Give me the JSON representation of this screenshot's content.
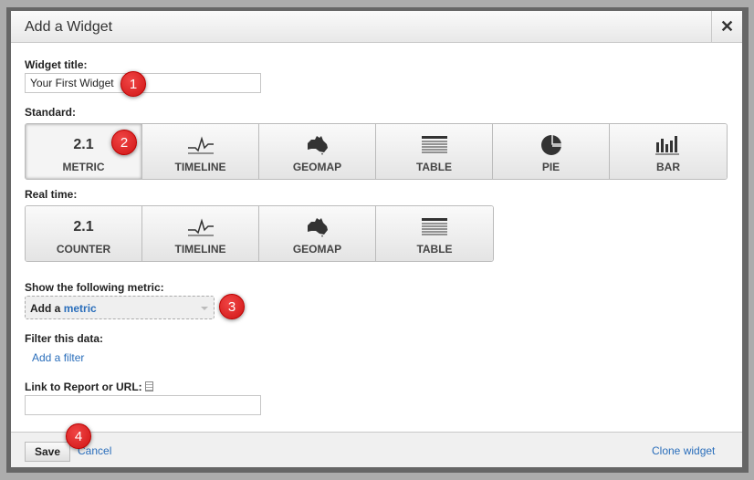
{
  "dialog": {
    "title": "Add a Widget",
    "close_label": "✕"
  },
  "widget_title": {
    "label": "Widget title:",
    "value": "Your First Widget"
  },
  "standard": {
    "label": "Standard:",
    "options": [
      {
        "icon": "2.1",
        "label": "METRIC",
        "selected": true
      },
      {
        "icon": "timeline-icon",
        "label": "TIMELINE"
      },
      {
        "icon": "australia-map-icon",
        "label": "GEOMAP"
      },
      {
        "icon": "table-icon",
        "label": "TABLE"
      },
      {
        "icon": "pie-icon",
        "label": "PIE"
      },
      {
        "icon": "bar-chart-icon",
        "label": "BAR"
      }
    ]
  },
  "realtime": {
    "label": "Real time:",
    "options": [
      {
        "icon": "2.1",
        "label": "COUNTER"
      },
      {
        "icon": "timeline-icon",
        "label": "TIMELINE"
      },
      {
        "icon": "australia-map-icon",
        "label": "GEOMAP"
      },
      {
        "icon": "table-icon",
        "label": "TABLE"
      }
    ]
  },
  "metric": {
    "label": "Show the following metric:",
    "prefix": "Add a",
    "link": "metric"
  },
  "filter": {
    "label": "Filter this data:",
    "link": "Add a filter"
  },
  "link_field": {
    "label": "Link to Report or URL:",
    "value": ""
  },
  "footer": {
    "save": "Save",
    "cancel": "Cancel",
    "clone": "Clone widget"
  },
  "badges": [
    "1",
    "2",
    "3",
    "4"
  ],
  "colors": {
    "link": "#2a6ebb",
    "badge": "#e02020"
  }
}
